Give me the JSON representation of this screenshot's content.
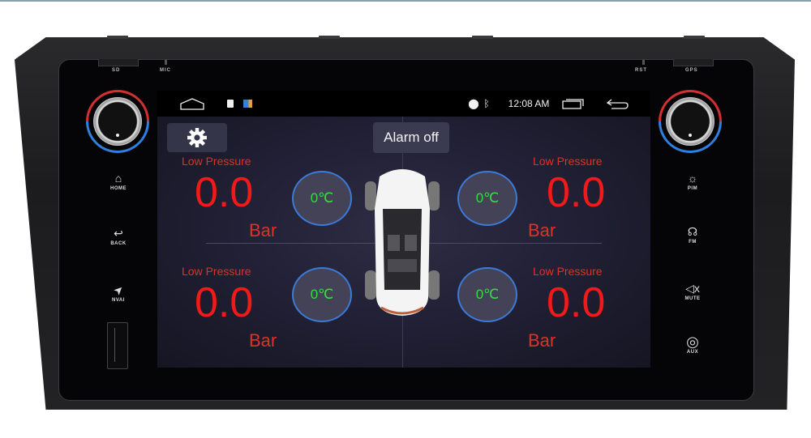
{
  "device": {
    "ports": {
      "sd": "SD",
      "mic": "MIC",
      "rst": "RST",
      "gps": "GPS"
    },
    "left_buttons": [
      {
        "icon": "home-icon",
        "label": "HOME"
      },
      {
        "icon": "back-icon",
        "label": "BACK"
      },
      {
        "icon": "navigation-arrow-icon",
        "label": "NVAI"
      }
    ],
    "right_buttons": [
      {
        "icon": "light-bulb-icon",
        "label": "PIM"
      },
      {
        "icon": "radio-antenna-icon",
        "label": "FM"
      },
      {
        "icon": "mute-icon",
        "label": "MUTE"
      },
      {
        "icon": "aux-jack-icon",
        "label": "AUX"
      }
    ],
    "knob_colors": {
      "cold": "#2f7fe0",
      "hot": "#d23030"
    }
  },
  "statusbar": {
    "time": "12:08 AM",
    "icons": [
      "home-outline-icon",
      "sd-card-icon",
      "app-notification-icon",
      "location-pin-icon",
      "bluetooth-icon",
      "recent-apps-icon",
      "back-arrow-icon"
    ]
  },
  "tpms": {
    "alarm_button": "Alarm off",
    "settings_icon": "gear-icon",
    "tires": [
      {
        "position": "front-left",
        "status": "Low Pressure",
        "pressure": "0.0",
        "unit": "Bar",
        "temperature": "0℃"
      },
      {
        "position": "front-right",
        "status": "Low Pressure",
        "pressure": "0.0",
        "unit": "Bar",
        "temperature": "0℃"
      },
      {
        "position": "rear-left",
        "status": "Low Pressure",
        "pressure": "0.0",
        "unit": "Bar",
        "temperature": "0℃"
      },
      {
        "position": "rear-right",
        "status": "Low Pressure",
        "pressure": "0.0",
        "unit": "Bar",
        "temperature": "0℃"
      }
    ],
    "colors": {
      "pressure": "#f01a1a",
      "temperature": "#33dd44",
      "ring": "#3b7ad6"
    }
  }
}
